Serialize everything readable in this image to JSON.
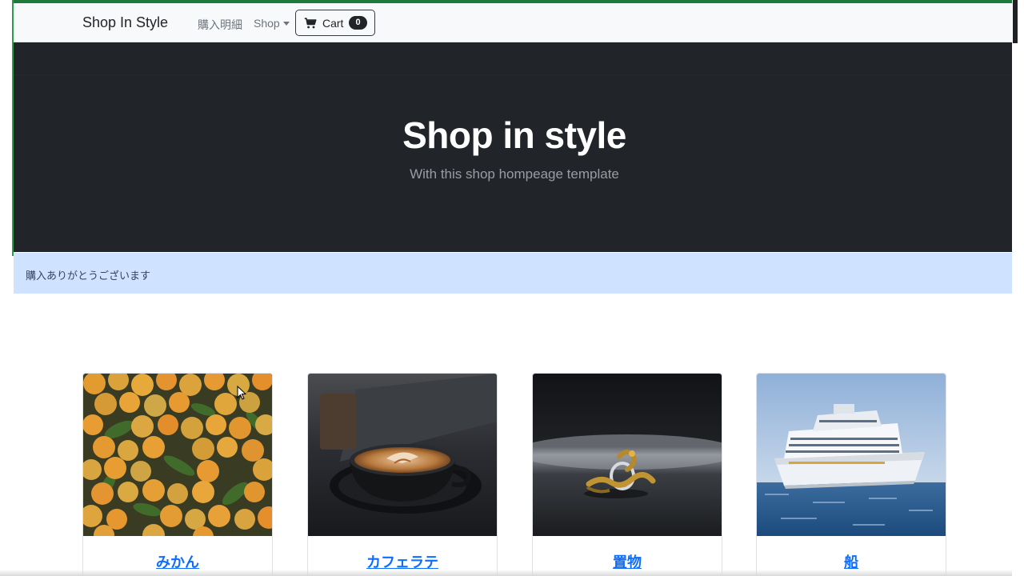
{
  "navbar": {
    "brand": "Shop In Style",
    "links": {
      "history": "購入明細",
      "shop": "Shop"
    },
    "cart": {
      "label": "Cart",
      "count": "0"
    }
  },
  "hero": {
    "title": "Shop in style",
    "subtitle": "With this shop hompeage template"
  },
  "alert": {
    "message": "購入ありがとうございます"
  },
  "products": [
    {
      "name": "みかん",
      "image": "mandarin-oranges-photo"
    },
    {
      "name": "カフェラテ",
      "image": "latte-art-cup-photo"
    },
    {
      "name": "置物",
      "image": "dragon-ring-figurine-photo"
    },
    {
      "name": "船",
      "image": "cruise-ship-photo"
    }
  ],
  "colors": {
    "accent_green": "#1e7a3a",
    "navbar_bg": "#f8f9fa",
    "hero_bg": "#212529",
    "alert_bg": "#cfe2ff",
    "link_blue": "#0d6efd"
  }
}
